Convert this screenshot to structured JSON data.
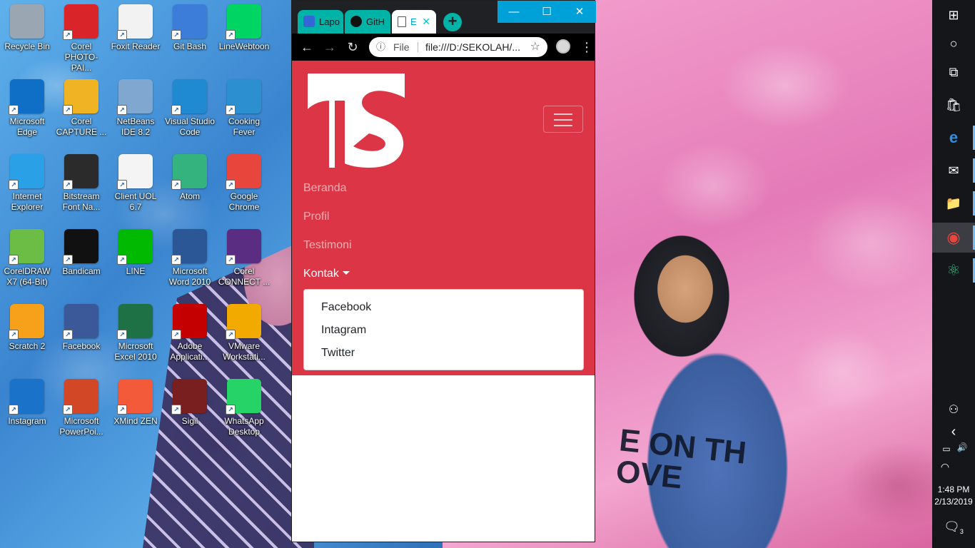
{
  "desktop": {
    "icons": [
      {
        "label": "Recycle Bin",
        "icon": "recycle-bin-icon",
        "color": "#9aa7b3"
      },
      {
        "label": "Corel PHOTO-PAI...",
        "icon": "corel-photopaint-icon",
        "color": "#d9252a"
      },
      {
        "label": "Foxit Reader",
        "icon": "foxit-reader-icon",
        "color": "#f2f2f2"
      },
      {
        "label": "Git Bash",
        "icon": "git-bash-icon",
        "color": "#3b7dd8"
      },
      {
        "label": "LineWebtoon",
        "icon": "line-webtoon-icon",
        "color": "#00d564"
      },
      {
        "label": "Microsoft Edge",
        "icon": "edge-icon",
        "color": "#0f6fc6"
      },
      {
        "label": "Corel CAPTURE ...",
        "icon": "corel-capture-icon",
        "color": "#f0b323"
      },
      {
        "label": "NetBeans IDE 8.2",
        "icon": "netbeans-icon",
        "color": "#7fa7cf"
      },
      {
        "label": "Visual Studio Code",
        "icon": "vscode-icon",
        "color": "#1f8ad2"
      },
      {
        "label": "Cooking Fever",
        "icon": "cooking-fever-icon",
        "color": "#2c8fcf"
      },
      {
        "label": "Internet Explorer",
        "icon": "internet-explorer-icon",
        "color": "#2aa0e6"
      },
      {
        "label": "Bitstream Font Na...",
        "icon": "bitstream-font-icon",
        "color": "#2b2b2b"
      },
      {
        "label": "Client UOL 6.7",
        "icon": "client-uol-icon",
        "color": "#f4f4f4"
      },
      {
        "label": "Atom",
        "icon": "atom-icon",
        "color": "#35b37e"
      },
      {
        "label": "Google Chrome",
        "icon": "chrome-icon",
        "color": "#e8453c"
      },
      {
        "label": "CorelDRAW X7 (64-Bit)",
        "icon": "coreldraw-icon",
        "color": "#6cbd45"
      },
      {
        "label": "Bandicam",
        "icon": "bandicam-icon",
        "color": "#111111"
      },
      {
        "label": "LINE",
        "icon": "line-icon",
        "color": "#00b900"
      },
      {
        "label": "Microsoft Word 2010",
        "icon": "word-icon",
        "color": "#2b5797"
      },
      {
        "label": "Corel CONNECT ...",
        "icon": "corel-connect-icon",
        "color": "#5a2d82"
      },
      {
        "label": "Scratch 2",
        "icon": "scratch-icon",
        "color": "#f7a11b"
      },
      {
        "label": "Facebook",
        "icon": "facebook-icon",
        "color": "#3b5998"
      },
      {
        "label": "Microsoft Excel 2010",
        "icon": "excel-icon",
        "color": "#1e7145"
      },
      {
        "label": "Adobe Applicati...",
        "icon": "adobe-icon",
        "color": "#c40000"
      },
      {
        "label": "VMware Workstati...",
        "icon": "vmware-icon",
        "color": "#f2a900"
      },
      {
        "label": "Instagram",
        "icon": "instagram-icon",
        "color": "#1a73c9"
      },
      {
        "label": "Microsoft PowerPoi...",
        "icon": "powerpoint-icon",
        "color": "#d24726"
      },
      {
        "label": "XMind ZEN",
        "icon": "xmind-icon",
        "color": "#f25a3a"
      },
      {
        "label": "Sigil",
        "icon": "sigil-icon",
        "color": "#7a1f1f"
      },
      {
        "label": "WhatsApp Desktop",
        "icon": "whatsapp-icon",
        "color": "#25d366"
      }
    ]
  },
  "browser": {
    "tabs": [
      {
        "label": "Lapo",
        "icon": "contacts-icon"
      },
      {
        "label": "GitH",
        "icon": "github-icon"
      },
      {
        "label": "E",
        "icon": "page-icon"
      }
    ],
    "newtab_label": "+",
    "window_buttons": {
      "minimize": "—",
      "maximize": "☐",
      "close": "✕"
    },
    "toolbar": {
      "back": "←",
      "forward": "→",
      "reload": "↻",
      "scheme": "File",
      "url": "file:///D:/SEKOLAH/...",
      "bookmark": "☆",
      "menu": "⋮"
    },
    "colors": {
      "frame": "#202124",
      "accent": "#00b3a7",
      "navbar": "#dc3545"
    }
  },
  "page": {
    "brand_logo": "ts-logo",
    "nav": [
      {
        "label": "Beranda"
      },
      {
        "label": "Profil"
      },
      {
        "label": "Testimoni"
      },
      {
        "label": "Kontak"
      }
    ],
    "dropdown": [
      "Facebook",
      "Intagram",
      "Twitter"
    ]
  },
  "taskbar": {
    "items": [
      {
        "icon": "windows-start-icon",
        "glyph": "⊞"
      },
      {
        "icon": "cortana-icon",
        "glyph": "○"
      },
      {
        "icon": "task-view-icon",
        "glyph": "⧉"
      },
      {
        "icon": "store-icon",
        "glyph": "🛍"
      },
      {
        "icon": "edge-icon",
        "glyph": "e"
      },
      {
        "icon": "mail-icon",
        "glyph": "✉"
      },
      {
        "icon": "file-explorer-icon",
        "glyph": "📁"
      },
      {
        "icon": "chrome-icon",
        "glyph": "◉"
      },
      {
        "icon": "atom-icon",
        "glyph": "⚛"
      }
    ],
    "tray": {
      "people": "⚇",
      "chevron": "‹",
      "battery": "▭",
      "volume": "🔊",
      "wifi": "◠",
      "time": "1:48 PM",
      "date": "2/13/2019",
      "notifications": "3"
    }
  }
}
